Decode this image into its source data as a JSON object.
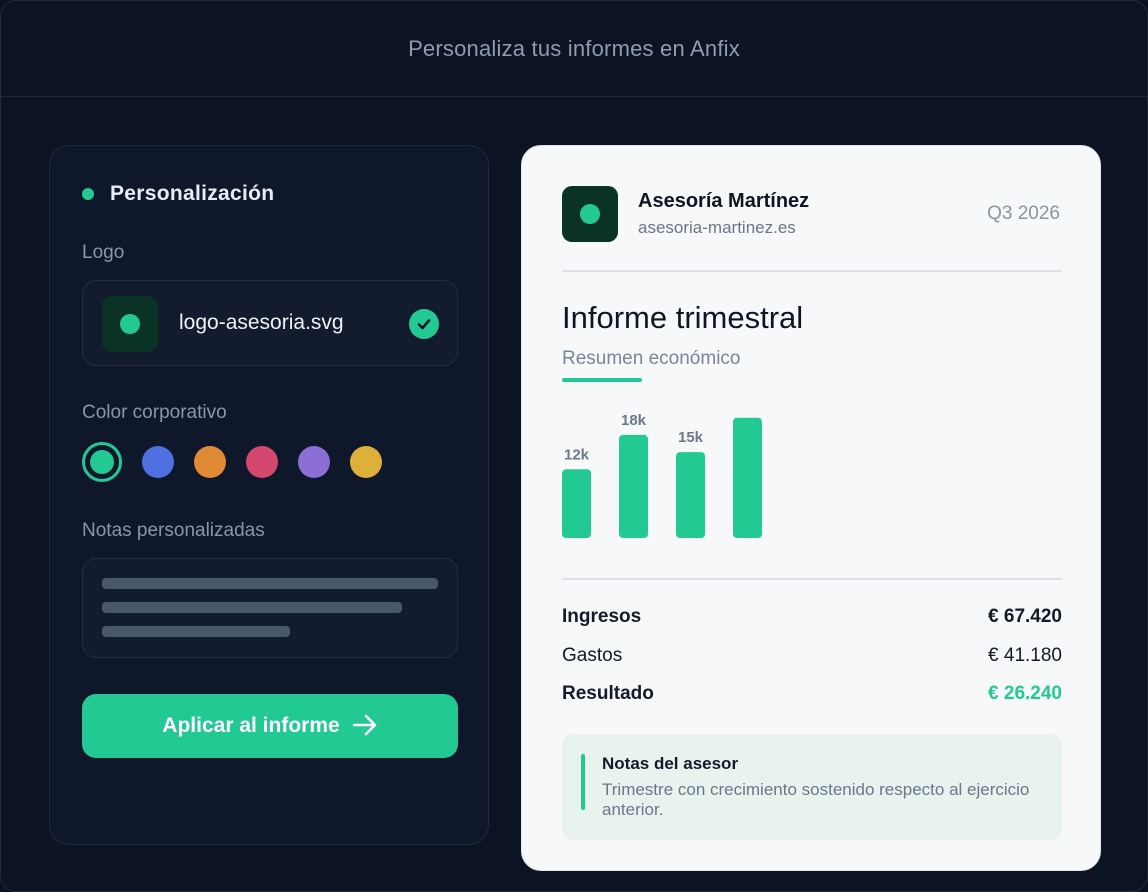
{
  "window": {
    "title": "Personaliza tus informes en Anfix"
  },
  "personalization": {
    "heading": "Personalización",
    "logo": {
      "label": "Logo",
      "filename": "logo-asesoria.svg",
      "status": "check-circle-icon"
    },
    "color": {
      "label": "Color corporativo",
      "swatches": [
        {
          "name": "green",
          "hex": "#22c993",
          "selected": true
        },
        {
          "name": "blue",
          "hex": "#4f70e0",
          "selected": false
        },
        {
          "name": "orange",
          "hex": "#e08a35",
          "selected": false
        },
        {
          "name": "pink",
          "hex": "#d44870",
          "selected": false
        },
        {
          "name": "purple",
          "hex": "#8c6fd4",
          "selected": false
        },
        {
          "name": "yellow",
          "hex": "#ddb03a",
          "selected": false
        }
      ]
    },
    "notes": {
      "label": "Notas personalizadas"
    },
    "apply_button": {
      "label": "Aplicar al informe",
      "icon": "arrow-right-icon"
    }
  },
  "report": {
    "company_name": "Asesoría Martínez",
    "company_domain": "asesoria-martinez.es",
    "period": "Q3 2026",
    "title": "Informe trimestral",
    "subtitle": "Resumen económico",
    "metrics": [
      {
        "label": "Ingresos",
        "value": "€ 67.420"
      },
      {
        "label": "Gastos",
        "value": "€ 41.180"
      },
      {
        "label": "Resultado",
        "value": "€ 26.240"
      }
    ],
    "advisor_notes": {
      "title": "Notas del asesor",
      "body": "Trimestre con crecimiento sostenido respecto al ejercicio anterior."
    }
  },
  "colors": {
    "accent": "#22c993",
    "background": "#0c1424",
    "report_bg": "#f6f8fa"
  },
  "chart_data": {
    "type": "bar",
    "categories": [
      "",
      "",
      "",
      ""
    ],
    "values": [
      12,
      18,
      15,
      21
    ],
    "data_labels": [
      "12k",
      "18k",
      "15k",
      ""
    ],
    "bar_color": "#22c993",
    "ylim": [
      0,
      22
    ]
  }
}
